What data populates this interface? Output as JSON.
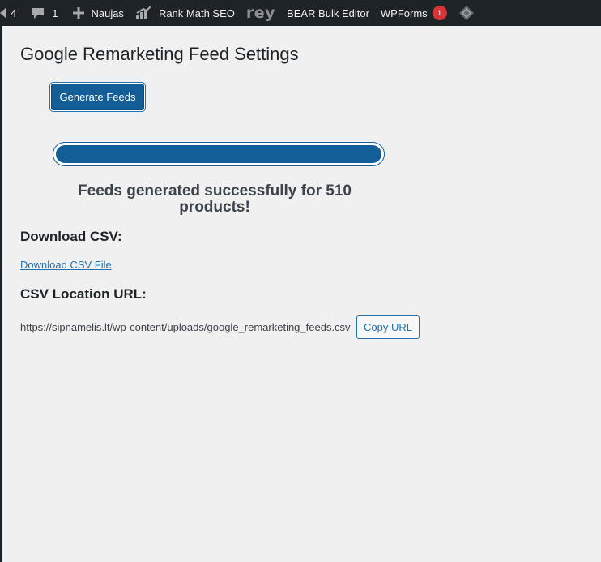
{
  "adminbar": {
    "updates_count": "4",
    "comments_count": "1",
    "new_label": "Naujas",
    "rankmath_label": "Rank Math SEO",
    "rey_label": "rey",
    "bear_label": "BEAR Bulk Editor",
    "wpforms_label": "WPForms",
    "wpforms_badge": "1",
    "icons": [
      "updates-icon",
      "comment-icon",
      "plus-icon",
      "rank-math-icon",
      "diamond-icon"
    ]
  },
  "page": {
    "title": "Google Remarketing Feed Settings",
    "generate_button": "Generate Feeds",
    "progress_percent": 100,
    "success_message": "Feeds generated successfully for 510 products!",
    "download_heading": "Download CSV:",
    "download_link": "Download CSV File",
    "url_heading": "CSV Location URL:",
    "csv_url": "https://sipnamelis.lt/wp-content/uploads/google_remarketing_feeds.csv",
    "copy_button": "Copy URL"
  },
  "colors": {
    "adminbar_bg": "#1d2327",
    "primary": "#135e96",
    "link": "#2271b1",
    "badge": "#d63638",
    "background": "#f0f0f1"
  }
}
